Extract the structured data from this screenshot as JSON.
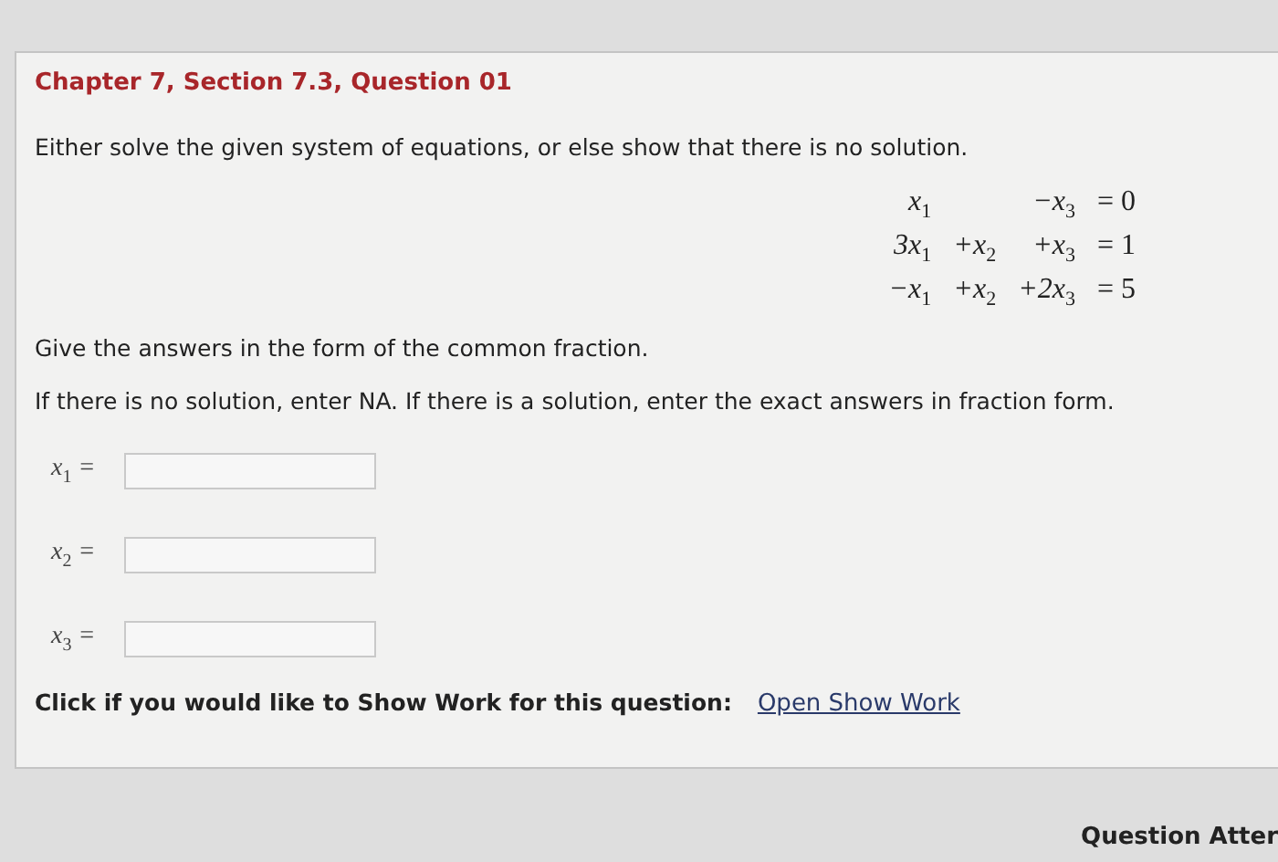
{
  "question": {
    "title": "Chapter 7, Section 7.3, Question 01",
    "prompt": "Either solve the given system of equations, or else show that there is no solution.",
    "equations": [
      {
        "term_1": "x$_{1}$",
        "term_3": "−x$_{3}$",
        "rhs": "= 0"
      },
      {
        "term_1": "3x$_{1}$",
        "term_2": "+x$_{2}$",
        "term_3": "+x$_{3}$",
        "rhs": "= 1"
      },
      {
        "term_1": "−x$_{1}$",
        "term_2": "+x$_{2}$",
        "term_3": "+2x$_{3}$",
        "rhs": "= 5"
      }
    ],
    "instructions": [
      "Give the answers in the form of the common fraction.",
      "If there is no solution, enter NA. If there is a solution, enter the exact answers in fraction form."
    ],
    "answers": [
      {
        "label": "x$_{1}$ ="
      },
      {
        "label": "x$_{2}$ ="
      },
      {
        "label": "x$_{3}$ ="
      }
    ],
    "show_work": {
      "text": "Click if you would like to Show Work for this question:",
      "link": "Open Show Work"
    }
  },
  "footer": {
    "text": "Question Atter"
  }
}
